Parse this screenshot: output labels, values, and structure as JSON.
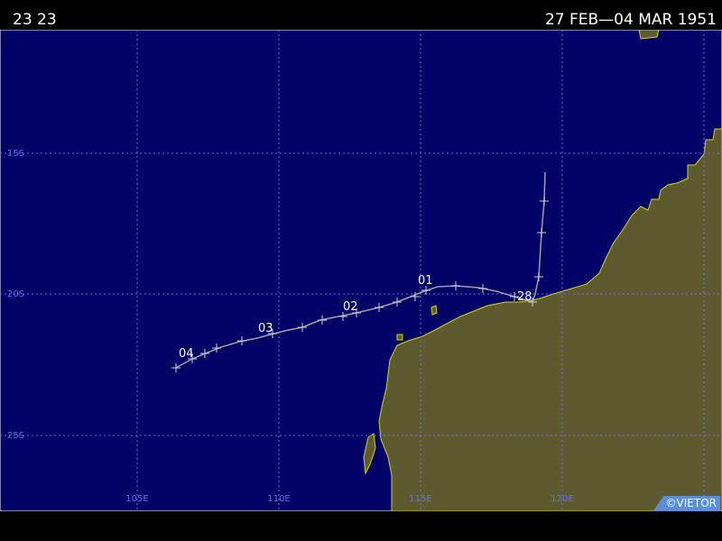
{
  "header": {
    "storm_id": "23 23",
    "date_range": "27 FEB—04 MAR 1951"
  },
  "map": {
    "lat_labels": [
      "15S",
      "20S",
      "25S"
    ],
    "lon_labels": [
      "105E",
      "110E",
      "115E",
      "120E"
    ],
    "day_labels": [
      "28",
      "01",
      "02",
      "03",
      "04"
    ],
    "credit": "©VIETOR",
    "colors": {
      "ocean": "#000066",
      "land": "#5c5a2e",
      "coastline": "#d8d800",
      "grid": "#6a6af0",
      "track": "#a0a0a0"
    }
  }
}
